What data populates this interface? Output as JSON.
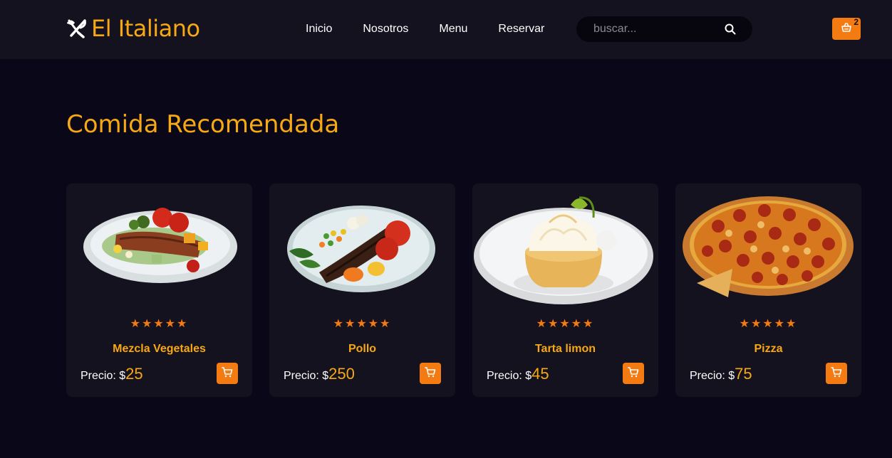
{
  "header": {
    "logo_icon": "utensils-cross-icon",
    "brand": "El Italiano",
    "nav": [
      {
        "label": "Inicio"
      },
      {
        "label": "Nosotros"
      },
      {
        "label": "Menu"
      },
      {
        "label": "Reservar"
      }
    ],
    "search": {
      "placeholder": "buscar...",
      "value": "",
      "icon": "search-icon"
    },
    "cart": {
      "icon": "basket-icon",
      "count": "2"
    }
  },
  "section": {
    "title": "Comida Recomendada",
    "items": [
      {
        "name": "Mezcla Vegetales",
        "rating": "★★★★★",
        "price_label": "Precio: $",
        "price": "25",
        "image": "mixed-vegetables-plate",
        "cart_icon": "cart-icon"
      },
      {
        "name": "Pollo",
        "rating": "★★★★★",
        "price_label": "Precio: $",
        "price": "250",
        "image": "chicken-plate",
        "cart_icon": "cart-icon"
      },
      {
        "name": "Tarta limon",
        "rating": "★★★★★",
        "price_label": "Precio: $",
        "price": "45",
        "image": "lemon-tart-plate",
        "cart_icon": "cart-icon"
      },
      {
        "name": "Pizza",
        "rating": "★★★★★",
        "price_label": "Precio: $",
        "price": "75",
        "image": "pepperoni-pizza",
        "cart_icon": "cart-icon"
      }
    ]
  },
  "colors": {
    "background": "#0a0818",
    "header": "#14121f",
    "card": "#14121f",
    "accent_yellow": "#f7a812",
    "accent_orange": "#f47a12"
  }
}
